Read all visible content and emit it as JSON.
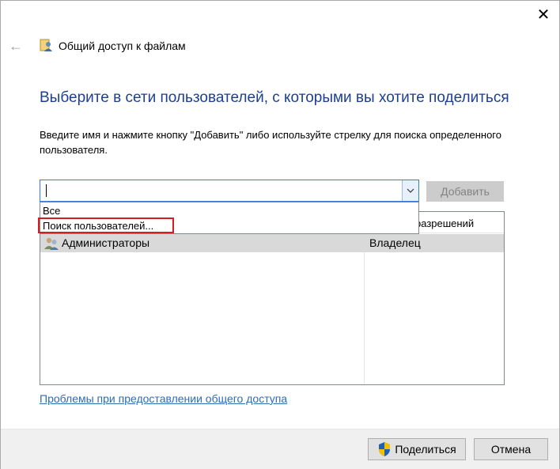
{
  "window": {
    "title": "Общий доступ к файлам",
    "close_glyph": "✕",
    "back_glyph": "←"
  },
  "main": {
    "heading": "Выберите в сети пользователей, с которыми вы хотите поделиться",
    "instructions": "Введите имя и нажмите кнопку \"Добавить\" либо используйте стрелку для поиска определенного пользователя.",
    "combo_value": "",
    "add_label": "Добавить"
  },
  "dropdown": {
    "items": [
      "Все",
      "Поиск пользователей..."
    ]
  },
  "table": {
    "permission_header": "разрешений",
    "rows": [
      {
        "name": "Администраторы",
        "permission": "Владелец"
      }
    ]
  },
  "help_link": "Проблемы при предоставлении общего доступа",
  "footer": {
    "share_label": "Поделиться",
    "cancel_label": "Отмена"
  },
  "colors": {
    "heading": "#1c3f94",
    "link": "#2c6db3",
    "highlight": "#d21f26",
    "selected_row": "#d9d9d9"
  },
  "icons": {
    "title": "share-users-icon",
    "row": "users-group-icon",
    "share": "uac-shield-icon",
    "combo": "chevron-down-icon"
  }
}
